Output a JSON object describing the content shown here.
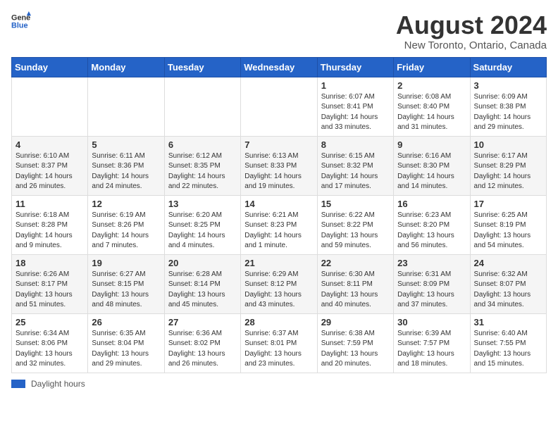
{
  "header": {
    "logo_general": "General",
    "logo_blue": "Blue",
    "month_year": "August 2024",
    "location": "New Toronto, Ontario, Canada"
  },
  "weekdays": [
    "Sunday",
    "Monday",
    "Tuesday",
    "Wednesday",
    "Thursday",
    "Friday",
    "Saturday"
  ],
  "footer": {
    "legend_label": "Daylight hours"
  },
  "weeks": [
    [
      {
        "day": "",
        "info": ""
      },
      {
        "day": "",
        "info": ""
      },
      {
        "day": "",
        "info": ""
      },
      {
        "day": "",
        "info": ""
      },
      {
        "day": "1",
        "info": "Sunrise: 6:07 AM\nSunset: 8:41 PM\nDaylight: 14 hours\nand 33 minutes."
      },
      {
        "day": "2",
        "info": "Sunrise: 6:08 AM\nSunset: 8:40 PM\nDaylight: 14 hours\nand 31 minutes."
      },
      {
        "day": "3",
        "info": "Sunrise: 6:09 AM\nSunset: 8:38 PM\nDaylight: 14 hours\nand 29 minutes."
      }
    ],
    [
      {
        "day": "4",
        "info": "Sunrise: 6:10 AM\nSunset: 8:37 PM\nDaylight: 14 hours\nand 26 minutes."
      },
      {
        "day": "5",
        "info": "Sunrise: 6:11 AM\nSunset: 8:36 PM\nDaylight: 14 hours\nand 24 minutes."
      },
      {
        "day": "6",
        "info": "Sunrise: 6:12 AM\nSunset: 8:35 PM\nDaylight: 14 hours\nand 22 minutes."
      },
      {
        "day": "7",
        "info": "Sunrise: 6:13 AM\nSunset: 8:33 PM\nDaylight: 14 hours\nand 19 minutes."
      },
      {
        "day": "8",
        "info": "Sunrise: 6:15 AM\nSunset: 8:32 PM\nDaylight: 14 hours\nand 17 minutes."
      },
      {
        "day": "9",
        "info": "Sunrise: 6:16 AM\nSunset: 8:30 PM\nDaylight: 14 hours\nand 14 minutes."
      },
      {
        "day": "10",
        "info": "Sunrise: 6:17 AM\nSunset: 8:29 PM\nDaylight: 14 hours\nand 12 minutes."
      }
    ],
    [
      {
        "day": "11",
        "info": "Sunrise: 6:18 AM\nSunset: 8:28 PM\nDaylight: 14 hours\nand 9 minutes."
      },
      {
        "day": "12",
        "info": "Sunrise: 6:19 AM\nSunset: 8:26 PM\nDaylight: 14 hours\nand 7 minutes."
      },
      {
        "day": "13",
        "info": "Sunrise: 6:20 AM\nSunset: 8:25 PM\nDaylight: 14 hours\nand 4 minutes."
      },
      {
        "day": "14",
        "info": "Sunrise: 6:21 AM\nSunset: 8:23 PM\nDaylight: 14 hours\nand 1 minute."
      },
      {
        "day": "15",
        "info": "Sunrise: 6:22 AM\nSunset: 8:22 PM\nDaylight: 13 hours\nand 59 minutes."
      },
      {
        "day": "16",
        "info": "Sunrise: 6:23 AM\nSunset: 8:20 PM\nDaylight: 13 hours\nand 56 minutes."
      },
      {
        "day": "17",
        "info": "Sunrise: 6:25 AM\nSunset: 8:19 PM\nDaylight: 13 hours\nand 54 minutes."
      }
    ],
    [
      {
        "day": "18",
        "info": "Sunrise: 6:26 AM\nSunset: 8:17 PM\nDaylight: 13 hours\nand 51 minutes."
      },
      {
        "day": "19",
        "info": "Sunrise: 6:27 AM\nSunset: 8:15 PM\nDaylight: 13 hours\nand 48 minutes."
      },
      {
        "day": "20",
        "info": "Sunrise: 6:28 AM\nSunset: 8:14 PM\nDaylight: 13 hours\nand 45 minutes."
      },
      {
        "day": "21",
        "info": "Sunrise: 6:29 AM\nSunset: 8:12 PM\nDaylight: 13 hours\nand 43 minutes."
      },
      {
        "day": "22",
        "info": "Sunrise: 6:30 AM\nSunset: 8:11 PM\nDaylight: 13 hours\nand 40 minutes."
      },
      {
        "day": "23",
        "info": "Sunrise: 6:31 AM\nSunset: 8:09 PM\nDaylight: 13 hours\nand 37 minutes."
      },
      {
        "day": "24",
        "info": "Sunrise: 6:32 AM\nSunset: 8:07 PM\nDaylight: 13 hours\nand 34 minutes."
      }
    ],
    [
      {
        "day": "25",
        "info": "Sunrise: 6:34 AM\nSunset: 8:06 PM\nDaylight: 13 hours\nand 32 minutes."
      },
      {
        "day": "26",
        "info": "Sunrise: 6:35 AM\nSunset: 8:04 PM\nDaylight: 13 hours\nand 29 minutes."
      },
      {
        "day": "27",
        "info": "Sunrise: 6:36 AM\nSunset: 8:02 PM\nDaylight: 13 hours\nand 26 minutes."
      },
      {
        "day": "28",
        "info": "Sunrise: 6:37 AM\nSunset: 8:01 PM\nDaylight: 13 hours\nand 23 minutes."
      },
      {
        "day": "29",
        "info": "Sunrise: 6:38 AM\nSunset: 7:59 PM\nDaylight: 13 hours\nand 20 minutes."
      },
      {
        "day": "30",
        "info": "Sunrise: 6:39 AM\nSunset: 7:57 PM\nDaylight: 13 hours\nand 18 minutes."
      },
      {
        "day": "31",
        "info": "Sunrise: 6:40 AM\nSunset: 7:55 PM\nDaylight: 13 hours\nand 15 minutes."
      }
    ]
  ]
}
